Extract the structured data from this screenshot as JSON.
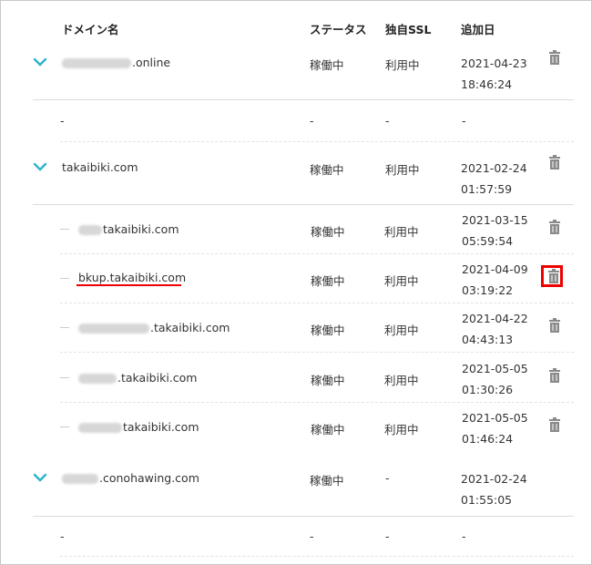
{
  "headers": {
    "domain": "ドメイン名",
    "status": "ステータス",
    "ssl": "独自SSL",
    "date": "追加日"
  },
  "rows": [
    {
      "domain_suffix": ".online",
      "status": "稼働中",
      "ssl": "利用中",
      "date": "2021-04-23",
      "time": "18:46:24"
    },
    {
      "domain_suffix": "-",
      "status": "-",
      "ssl": "-",
      "date": "-",
      "time": ""
    },
    {
      "domain_suffix": "takaibiki.com",
      "status": "稼働中",
      "ssl": "利用中",
      "date": "2021-02-24",
      "time": "01:57:59"
    },
    {
      "domain_suffix": "takaibiki.com",
      "status": "稼働中",
      "ssl": "利用中",
      "date": "2021-03-15",
      "time": "05:59:54"
    },
    {
      "domain_suffix": "bkup.takaibiki.com",
      "status": "稼働中",
      "ssl": "利用中",
      "date": "2021-04-09",
      "time": "03:19:22"
    },
    {
      "domain_suffix": ".takaibiki.com",
      "status": "稼働中",
      "ssl": "利用中",
      "date": "2021-04-22",
      "time": "04:43:13"
    },
    {
      "domain_suffix": ".takaibiki.com",
      "status": "稼働中",
      "ssl": "利用中",
      "date": "2021-05-05",
      "time": "01:30:26"
    },
    {
      "domain_suffix": "takaibiki.com",
      "status": "稼働中",
      "ssl": "利用中",
      "date": "2021-05-05",
      "time": "01:46:24"
    },
    {
      "domain_suffix": ".conohawing.com",
      "status": "稼働中",
      "ssl": "-",
      "date": "2021-02-24",
      "time": "01:55:05"
    },
    {
      "domain_suffix": "-",
      "status": "-",
      "ssl": "-",
      "date": "-",
      "time": ""
    }
  ],
  "icons": {
    "chevron": "chevron-down-icon",
    "trash": "trash-icon"
  },
  "colors": {
    "chevron": "#2bb3c9",
    "trash": "#8a8a8a",
    "highlight": "#e00000"
  }
}
